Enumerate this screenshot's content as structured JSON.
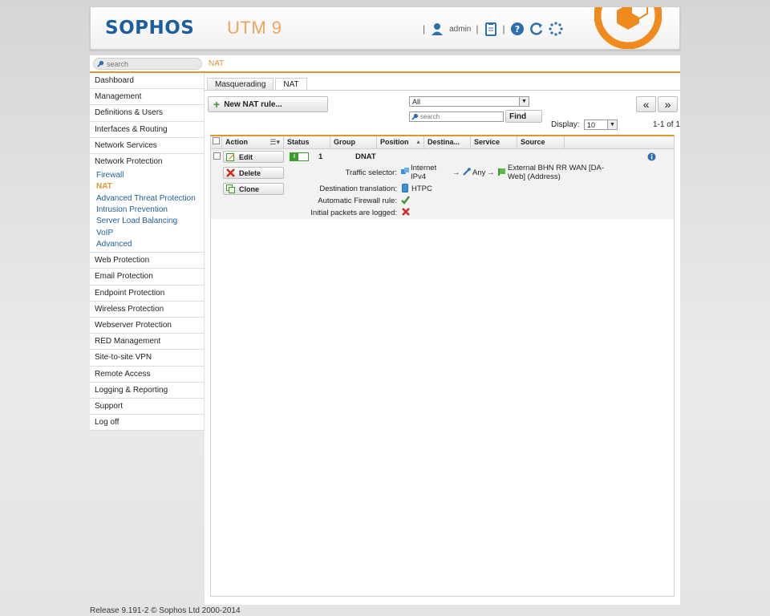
{
  "header": {
    "logo": "SOPHOS",
    "product": "UTM 9",
    "user": "admin",
    "icons": [
      "user-icon",
      "clipboard-icon",
      "help-icon",
      "refresh-icon",
      "spinner-icon"
    ],
    "brand_color": "#1c5e9e",
    "accent_color": "#e0962f"
  },
  "search": {
    "placeholder": "search"
  },
  "breadcrumb": "NAT",
  "sidebar": {
    "items_top": [
      {
        "label": "Dashboard"
      },
      {
        "label": "Management"
      },
      {
        "label": "Definitions & Users"
      },
      {
        "label": "Interfaces & Routing"
      },
      {
        "label": "Network Services"
      }
    ],
    "active_section": "Network Protection",
    "sub_items": [
      {
        "label": "Firewall"
      },
      {
        "label": "NAT"
      },
      {
        "label": "Advanced Threat Protection"
      },
      {
        "label": "Intrusion Prevention"
      },
      {
        "label": "Server Load Balancing"
      },
      {
        "label": "VoIP"
      },
      {
        "label": "Advanced"
      }
    ],
    "items_bottom": [
      {
        "label": "Web Protection"
      },
      {
        "label": "Email Protection"
      },
      {
        "label": "Endpoint Protection"
      },
      {
        "label": "Wireless Protection"
      },
      {
        "label": "Webserver Protection"
      },
      {
        "label": "RED Management"
      },
      {
        "label": "Site-to-site VPN"
      },
      {
        "label": "Remote Access"
      },
      {
        "label": "Logging & Reporting"
      },
      {
        "label": "Support"
      },
      {
        "label": "Log off"
      }
    ]
  },
  "tabs": [
    {
      "label": "Masquerading",
      "active": false
    },
    {
      "label": "NAT",
      "active": true
    }
  ],
  "toolbar": {
    "new_rule_label": "New NAT rule...",
    "filter_value": "All",
    "search_placeholder": "search",
    "find_label": "Find",
    "prev_label": "«",
    "next_label": "»",
    "display_label": "Display:",
    "display_value": "10",
    "count_text": "1-1 of 1"
  },
  "table": {
    "columns": [
      "Action",
      "Status",
      "Group",
      "Position",
      "Destina...",
      "Service",
      "Source"
    ],
    "rows": [
      {
        "edit_label": "Edit",
        "delete_label": "Delete",
        "clone_label": "Clone",
        "status": "on",
        "position": "1",
        "name": "DNAT",
        "traffic_selector_label": "Traffic selector:",
        "traffic_source": "Internet IPv4",
        "traffic_arrow1": "→",
        "traffic_service": "Any",
        "traffic_arrow2": "→",
        "traffic_destination": "External BHN RR WAN [DA-Web] (Address)",
        "dest_translation_label": "Destination translation:",
        "dest_translation_value": "HTPC",
        "auto_fw_label": "Automatic Firewall rule:",
        "auto_fw_value": "yes",
        "log_label": "Initial packets are logged:",
        "log_value": "no"
      }
    ]
  },
  "footer": "Release 9.191-2 © Sophos Ltd 2000-2014"
}
